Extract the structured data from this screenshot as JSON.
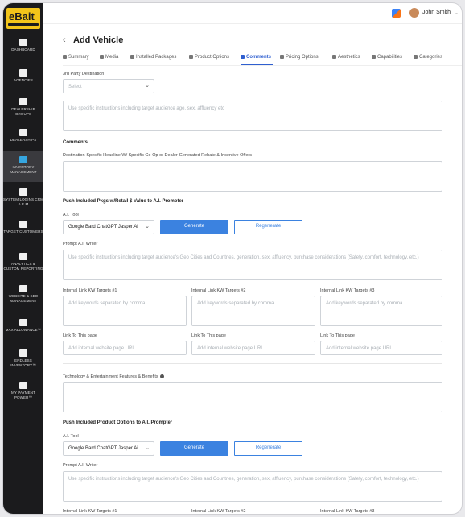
{
  "brand": {
    "logo_text": "eBait",
    "logo_tagline": "Ready to use AI marketing"
  },
  "sidebar": {
    "items": [
      {
        "label": "Dashboard"
      },
      {
        "label": "Agencies"
      },
      {
        "label": "Dealership Groups"
      },
      {
        "label": "Dealerships"
      },
      {
        "label": "Inventory Management"
      },
      {
        "label": "System Logins CRM & E.M"
      },
      {
        "label": "Target Customers"
      },
      {
        "label": "Analytics & Custom Reporting"
      },
      {
        "label": "Website & SEO Management"
      },
      {
        "label": "Max Allowance™"
      },
      {
        "label": "Endless Inventory™"
      },
      {
        "label": "My Payment Power™"
      }
    ]
  },
  "header": {
    "user_name": "John Smith"
  },
  "page": {
    "title": "Add Vehicle",
    "tabs": [
      "Summary",
      "Media",
      "Installed Packages",
      "Product Options",
      "Comments",
      "Pricing Options",
      "Aesthetics",
      "Capabilities",
      "Categories"
    ]
  },
  "form": {
    "third_party_label": "3rd Party Destination",
    "third_party_placeholder": "Select",
    "instructions_placeholder": "Use specific instructions including target audience age, sex, affluency etc",
    "comments_heading": "Comments",
    "destination_label": "Destination-Specific Headline W/ Specific Co-Op or Dealer-Generated Rebate & Incentive Offers",
    "section1": {
      "heading": "Push Included Pkgs w/Retail $ Value to A.I. Promoter",
      "ai_tool_label": "A.I. Tool",
      "ai_tool_value": "Google Bard ChatGPT Jasper.Ai",
      "generate": "Generate",
      "regenerate": "Regenerate",
      "prompt_label": "Prompt A.I. Writer",
      "prompt_placeholder": "Use specific instructions including target audience's Geo Cities and Countries, generation, sex, affluency, purchase considerations (Safety, comfort, technology, etc.)",
      "kw1_label": "Internal Link KW Targets #1",
      "kw2_label": "Internal Link KW Targets #2",
      "kw3_label": "Internal Link KW Targets #3",
      "kw1_placeholder": "Add keywords separated by comma",
      "kw2_placeholder": "Add keywords separated by comma",
      "kw3_placeholder": "Add keywords separated by comma",
      "link_label": "Link To This page",
      "link_placeholder": "Add internal website page URL"
    },
    "tech_label": "Technology & Entertainment Features & Benefits",
    "section2": {
      "heading": "Push Included Product Options to A.I. Prompter",
      "ai_tool_label": "A.I. Tool",
      "ai_tool_value": "Google Bard ChatGPT Jasper.Ai",
      "generate": "Generate",
      "regenerate": "Regenerate",
      "prompt_label": "Prompt A.I. Writer",
      "prompt_placeholder": "Use specific instructions including target audience's Geo Cities and Countries, generation, sex, affluency, purchase considerations (Safety, comfort, technology, etc.)",
      "kw1_label": "Internal Link KW Targets #1",
      "kw2_label": "Internal Link KW Targets #2",
      "kw3_label": "Internal Link KW Targets #3"
    }
  }
}
